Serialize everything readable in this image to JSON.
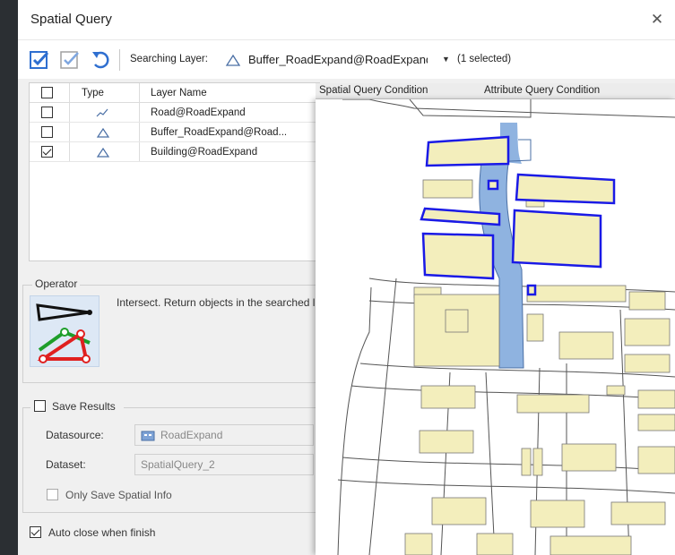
{
  "window": {
    "title": "Spatial Query"
  },
  "toolbar": {
    "searching_label": "Searching Layer:",
    "searching_layer": "Buffer_RoadExpand@RoadExpand",
    "selected_count": "(1 selected)"
  },
  "layer_table": {
    "headers": {
      "type": "Type",
      "name": "Layer Name"
    },
    "rows": [
      {
        "name": "Road@RoadExpand",
        "type_icon": "line-layer-icon",
        "checked": false
      },
      {
        "name": "Buffer_RoadExpand@Road...",
        "type_icon": "region-layer-icon",
        "checked": false
      },
      {
        "name": "Building@RoadExpand",
        "type_icon": "region-layer-icon",
        "checked": true
      }
    ]
  },
  "condition_tabs": {
    "spatial": "Spatial Query Condition",
    "attribute": "Attribute Query Condition"
  },
  "operator": {
    "group_title": "Operator",
    "description": "Intersect. Return objects in the searched layer that intersect the searching object."
  },
  "save_results": {
    "label": "Save Results",
    "checked": false,
    "datasource_label": "Datasource:",
    "datasource_value": "RoadExpand",
    "dataset_label": "Dataset:",
    "dataset_value": "SpatialQuery_2",
    "only_spatial_label": "Only Save Spatial Info"
  },
  "auto_close": {
    "label": "Auto close when finish",
    "checked": true
  },
  "colors": {
    "accent": "#2f6fd0",
    "building_fill": "#f3eebc",
    "buffer_fill": "#8fb3e0",
    "highlight_stroke": "#1a1ae6"
  }
}
